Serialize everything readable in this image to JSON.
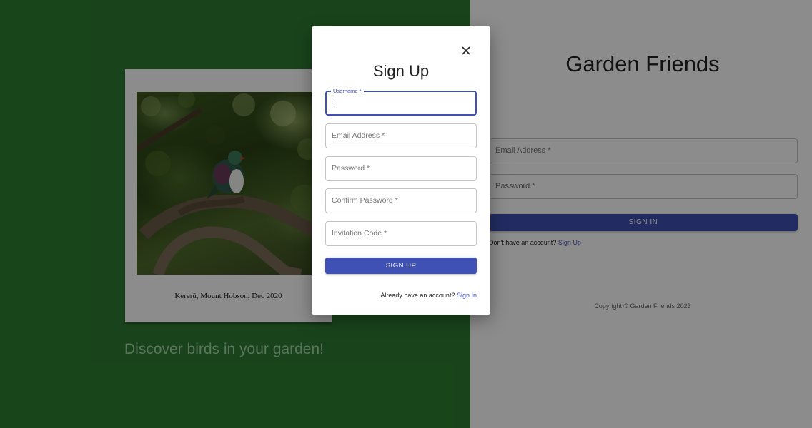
{
  "background": {
    "left": {
      "photo_caption": "Kererū, Mount Hobson, Dec 2020",
      "tagline": "Discover birds in your garden!"
    },
    "right": {
      "title": "Garden Friends",
      "email_label": "Email Address *",
      "password_label": "Password *",
      "signin_button": "SIGN IN",
      "no_account_text": "Don't have an account?",
      "signup_link": "Sign Up",
      "copyright": "Copyright © Garden Friends 2023"
    }
  },
  "modal": {
    "title": "Sign Up",
    "close_icon": "close-icon",
    "fields": {
      "username": {
        "label": "Username *",
        "value": ""
      },
      "email": {
        "label": "Email Address *"
      },
      "password": {
        "label": "Password *"
      },
      "confirm_password": {
        "label": "Confirm Password *"
      },
      "invitation_code": {
        "label": "Invitation Code *"
      }
    },
    "submit_button": "SIGN UP",
    "have_account_text": "Already have an account?",
    "signin_link": "Sign In"
  },
  "colors": {
    "primary": "#3f51b5",
    "left_panel": "#2e7d32",
    "tagline": "#a5d6a7"
  }
}
